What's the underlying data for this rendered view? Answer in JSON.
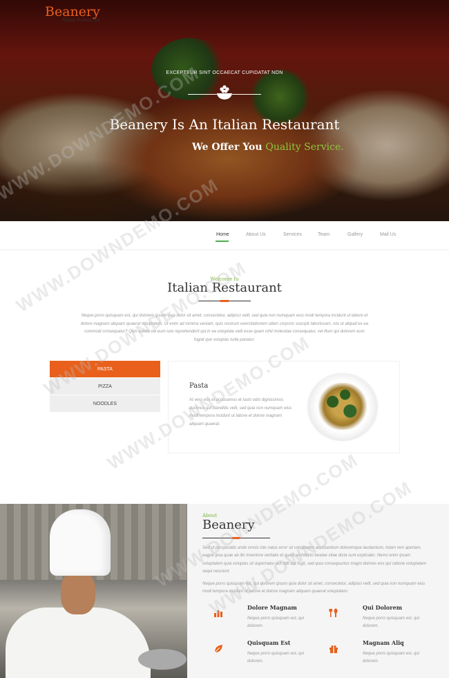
{
  "hero": {
    "kicker": "EXCEPTEUR SINT OCCAECAT CUPIDATAT NON",
    "title": "Beanery Is An Italian Restaurant",
    "subtitle_prefix": "We Offer You",
    "subtitle_accent": "Quality Service."
  },
  "brand": {
    "logo": "Beanery",
    "logo_sub": "Italian Restaurant",
    "accent_color": "#e8601c",
    "green_color": "#7ab43a"
  },
  "nav": {
    "items": [
      "Home",
      "About Us",
      "Services",
      "Team",
      "Gallery",
      "Mail Us"
    ],
    "active": "Home"
  },
  "welcome": {
    "small": "Welcome to",
    "title": "Italian Restaurant",
    "text": "Neque porro quisquam est, qui dolorem ipsum quia dolor sit amet, consectetur, adipisci velit, sed quia non numquam eius modi tempora incidunt ut labore et dolore magnam aliquam quaerat voluptatem. Ut enim ad minima veniam, quis nostrum exercitationem ullam corporis suscipit laboriosam, nisi ut aliquid ex ea commodi consequatur? Quis autem vel eum iure reprehenderit qui in ea voluptate velit esse quam nihil molestiae consequatur, vel illum qui dolorem eum fugiat quo voluptas nulla pariatur."
  },
  "menu_tabs": {
    "items": [
      "PASTA",
      "PIZZA",
      "NOODLES"
    ],
    "active": "PASTA",
    "panel_title": "Pasta",
    "panel_text": "At vero eos et accusamus et iusto odio dignissimos ducimus qui blanditiis velit, sed quia non numquam eius modi tempora incidunt ut labore et dolore magnam aliquam quaerat."
  },
  "about": {
    "small": "About",
    "title": "Beanery",
    "p1": "Sed ut perspiciatis unde omnis iste natus error sit voluptatem accusantium doloremque laudantium, totam rem aperiam, eaque ipsa quae ab illo inventore veritatis et quasi architecto beatae vitae dicta sunt explicabo. Nemo enim ipsam voluptatem quia voluptas sit aspernatur aut odit aut fugit, sed quia consequuntur magni dolores eos qui ratione voluptatem sequi nesciunt.",
    "p2": "Neque porro quisquam est, qui dolorem ipsum quia dolor sit amet, consectetur, adipisci velit, sed quia non numquam eius modi tempora incidunt ut labore et dolore magnam aliquam quaerat voluptatem.",
    "features": [
      {
        "icon": "bar-chart-icon",
        "title": "Dolore Magnam",
        "text": "Neque porro quisquam est, qui dolorem."
      },
      {
        "icon": "cutlery-icon",
        "title": "Qui Dolorem",
        "text": "Neque porro quisquam est, qui dolorem."
      },
      {
        "icon": "leaf-icon",
        "title": "Quisquam Est",
        "text": "Neque porro quisquam est, qui dolorem."
      },
      {
        "icon": "gift-icon",
        "title": "Magnam Aliq",
        "text": "Neque porro quisquam est, qui dolorem."
      }
    ]
  },
  "watermark": "WWW.DOWNDEMO.COM"
}
